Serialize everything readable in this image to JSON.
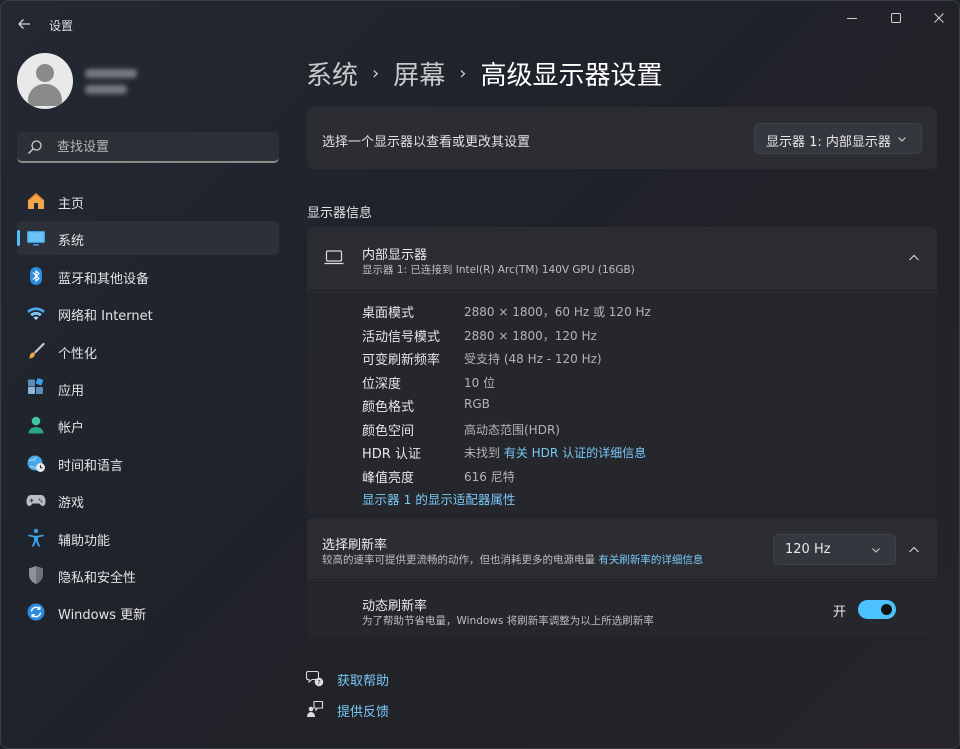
{
  "window": {
    "title": "设置"
  },
  "search": {
    "placeholder": "查找设置"
  },
  "sidebar": {
    "items": [
      {
        "label": "主页",
        "icon": "home-icon",
        "active": false
      },
      {
        "label": "系统",
        "icon": "system-display-icon",
        "active": true
      },
      {
        "label": "蓝牙和其他设备",
        "icon": "bluetooth-icon",
        "active": false
      },
      {
        "label": "网络和 Internet",
        "icon": "wifi-icon",
        "active": false
      },
      {
        "label": "个性化",
        "icon": "brush-icon",
        "active": false
      },
      {
        "label": "应用",
        "icon": "apps-icon",
        "active": false
      },
      {
        "label": "帐户",
        "icon": "account-icon",
        "active": false
      },
      {
        "label": "时间和语言",
        "icon": "globe-clock-icon",
        "active": false
      },
      {
        "label": "游戏",
        "icon": "gamepad-icon",
        "active": false
      },
      {
        "label": "辅助功能",
        "icon": "accessibility-icon",
        "active": false
      },
      {
        "label": "隐私和安全性",
        "icon": "shield-icon",
        "active": false
      },
      {
        "label": "Windows 更新",
        "icon": "update-icon",
        "active": false
      }
    ]
  },
  "breadcrumb": {
    "parts": [
      "系统",
      "屏幕",
      "高级显示器设置"
    ]
  },
  "display_select": {
    "label": "选择一个显示器以查看或更改其设置",
    "value": "显示器 1: 内部显示器"
  },
  "display_info": {
    "section_title": "显示器信息",
    "title": "内部显示器",
    "subtitle": "显示器 1: 已连接到 Intel(R) Arc(TM) 140V GPU (16GB)",
    "props": [
      {
        "key": "桌面模式",
        "value": "2880 × 1800，60 Hz 或 120 Hz"
      },
      {
        "key": "活动信号模式",
        "value": "2880 × 1800，120 Hz"
      },
      {
        "key": "可变刷新频率",
        "value": "受支持 (48 Hz - 120 Hz)"
      },
      {
        "key": "位深度",
        "value": "10 位"
      },
      {
        "key": "颜色格式",
        "value": "RGB"
      },
      {
        "key": "颜色空间",
        "value": "高动态范围(HDR)"
      },
      {
        "key": "HDR 认证",
        "value": "未找到",
        "link": "有关 HDR 认证的详细信息"
      },
      {
        "key": "峰值亮度",
        "value": "616 尼特"
      }
    ],
    "adapter_link": "显示器 1 的显示适配器属性"
  },
  "refresh": {
    "title": "选择刷新率",
    "desc": "较高的速率可提供更流畅的动作，但也消耗更多的电源电量",
    "desc_link": "有关刷新率的详细信息",
    "value": "120 Hz",
    "dynamic": {
      "title": "动态刷新率",
      "desc": "为了帮助节省电量，Windows 将刷新率调整为以上所选刷新率",
      "state": "开",
      "on": true
    }
  },
  "footer": {
    "help": "获取帮助",
    "feedback": "提供反馈"
  },
  "colors": {
    "accent": "#4cc2ff",
    "link": "#79c9f5"
  }
}
